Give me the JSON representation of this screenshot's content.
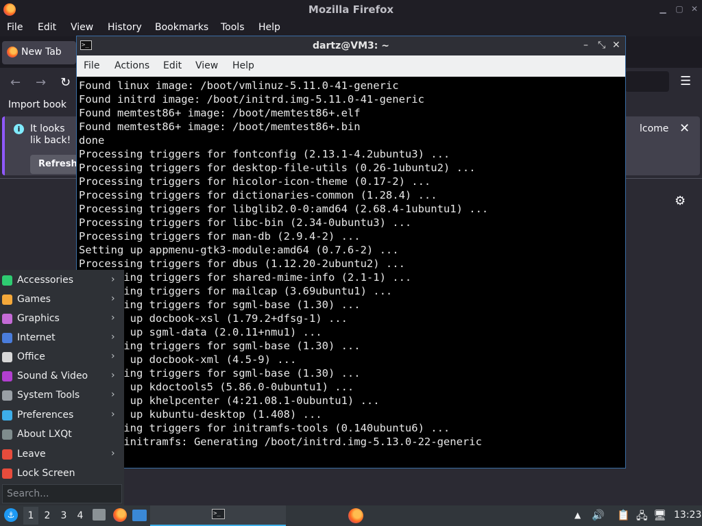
{
  "firefox": {
    "window_title": "Mozilla Firefox",
    "menu": [
      "File",
      "Edit",
      "View",
      "History",
      "Bookmarks",
      "Tools",
      "Help"
    ],
    "tab_label": "New Tab",
    "bookmarks_import": "Import book",
    "notice_text": "It looks lik back!",
    "notice_right": "lcome",
    "refresh_label": "Refresh",
    "icons": {
      "back": "←",
      "forward": "→",
      "reload": "↻",
      "menu": "☰",
      "close": "✕",
      "gear": "⚙",
      "min": "▁",
      "max": "▢",
      "wclose": "✕"
    }
  },
  "terminal": {
    "title": "dartz@VM3: ~",
    "icon_text": ">_",
    "menu": [
      "File",
      "Actions",
      "Edit",
      "View",
      "Help"
    ],
    "wm": {
      "min": "–",
      "max": "⤡",
      "close": "✕"
    },
    "lines": [
      "Found linux image: /boot/vmlinuz-5.11.0-41-generic",
      "Found initrd image: /boot/initrd.img-5.11.0-41-generic",
      "Found memtest86+ image: /boot/memtest86+.elf",
      "Found memtest86+ image: /boot/memtest86+.bin",
      "done",
      "Processing triggers for fontconfig (2.13.1-4.2ubuntu3) ...",
      "Processing triggers for desktop-file-utils (0.26-1ubuntu2) ...",
      "Processing triggers for hicolor-icon-theme (0.17-2) ...",
      "Processing triggers for dictionaries-common (1.28.4) ...",
      "Processing triggers for libglib2.0-0:amd64 (2.68.4-1ubuntu1) ...",
      "Processing triggers for libc-bin (2.34-0ubuntu3) ...",
      "Processing triggers for man-db (2.9.4-2) ...",
      "Setting up appmenu-gtk3-module:amd64 (0.7.6-2) ...",
      "Processing triggers for dbus (1.12.20-2ubuntu2) ...",
      "Processing triggers for shared-mime-info (2.1-1) ...",
      "Processing triggers for mailcap (3.69ubuntu1) ...",
      "Processing triggers for sgml-base (1.30) ...",
      "Setting up docbook-xsl (1.79.2+dfsg-1) ...",
      "Setting up sgml-data (2.0.11+nmu1) ...",
      "Processing triggers for sgml-base (1.30) ...",
      "Setting up docbook-xml (4.5-9) ...",
      "Processing triggers for sgml-base (1.30) ...",
      "Setting up kdoctools5 (5.86.0-0ubuntu1) ...",
      "Setting up khelpcenter (4:21.08.1-0ubuntu1) ...",
      "Setting up kubuntu-desktop (1.408) ...",
      "Processing triggers for initramfs-tools (0.140ubuntu6) ...",
      "update-initramfs: Generating /boot/initrd.img-5.13.0-22-generic"
    ]
  },
  "lxqt_menu": {
    "items": [
      {
        "label": "Accessories",
        "icon": "accessories-icon",
        "color": "#2ecc71",
        "submenu": true
      },
      {
        "label": "Games",
        "icon": "games-icon",
        "color": "#f4a83a",
        "submenu": true
      },
      {
        "label": "Graphics",
        "icon": "graphics-icon",
        "color": "#c46bd6",
        "submenu": true
      },
      {
        "label": "Internet",
        "icon": "internet-icon",
        "color": "#4a7ddc",
        "submenu": true
      },
      {
        "label": "Office",
        "icon": "office-icon",
        "color": "#d8d8d8",
        "submenu": true
      },
      {
        "label": "Sound & Video",
        "icon": "sound-video-icon",
        "color": "#b23fd0",
        "submenu": true
      },
      {
        "label": "System Tools",
        "icon": "system-tools-icon",
        "color": "#9aa0a6",
        "submenu": true
      },
      {
        "label": "Preferences",
        "icon": "preferences-icon",
        "color": "#3daee9",
        "submenu": true
      },
      {
        "label": "About LXQt",
        "icon": "about-icon",
        "color": "#7f8c8d",
        "submenu": false
      },
      {
        "label": "Leave",
        "icon": "leave-icon",
        "color": "#e74c3c",
        "submenu": true
      },
      {
        "label": "Lock Screen",
        "icon": "lock-icon",
        "color": "#e74c3c",
        "submenu": false
      }
    ],
    "arrow": "›",
    "search_placeholder": "Search..."
  },
  "panel": {
    "start_glyph": "⚓",
    "desktops": [
      "1",
      "2",
      "3",
      "4"
    ],
    "volume_glyph": "🔊",
    "tray_glyphs": [
      "▲",
      "📋",
      "🖧",
      "🖥"
    ],
    "clock": "13:23"
  }
}
